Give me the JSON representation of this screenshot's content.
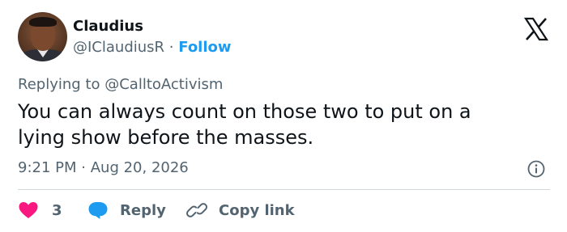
{
  "user": {
    "name": "Claudius",
    "handle": "@IClaudiusR",
    "separator": "·",
    "follow_label": "Follow"
  },
  "tweet": {
    "replying_prefix": "Replying to",
    "replying_to": "@CalltoActivism",
    "text": "You can always count on those two to put on a lying show before the masses.",
    "time": "9:21 PM",
    "date_separator": "·",
    "date": "Aug 20, 2026"
  },
  "actions": {
    "like_count": "3",
    "reply_label": "Reply",
    "copy_label": "Copy link"
  },
  "icons": {
    "brand": "x-logo-icon",
    "info": "info-icon",
    "like": "heart-icon",
    "reply": "speech-bubble-icon",
    "copy": "link-icon"
  },
  "colors": {
    "accent": "#1d9bf0",
    "like": "#f91880",
    "text": "#0f1419",
    "secondary": "#536471",
    "divider": "#cfd9de"
  }
}
